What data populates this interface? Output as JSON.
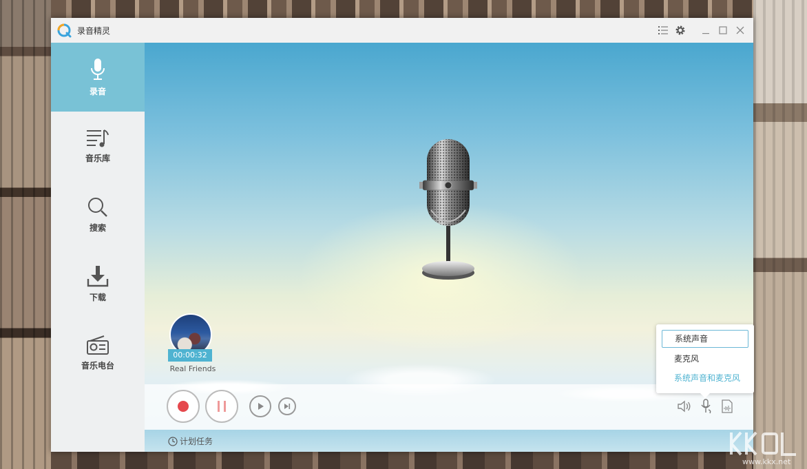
{
  "window": {
    "title": "录音精灵",
    "accent_color": "#79c2d6",
    "controls": {
      "list": "list-icon",
      "settings": "gear-icon",
      "minimize": "minimize-icon",
      "maximize": "maximize-icon",
      "close": "close-icon"
    }
  },
  "sidebar": {
    "items": [
      {
        "label": "录音",
        "icon": "microphone-icon",
        "active": true
      },
      {
        "label": "音乐库",
        "icon": "music-list-icon",
        "active": false
      },
      {
        "label": "搜索",
        "icon": "search-icon",
        "active": false
      },
      {
        "label": "下载",
        "icon": "download-icon",
        "active": false
      },
      {
        "label": "音乐电台",
        "icon": "radio-icon",
        "active": false
      }
    ]
  },
  "track": {
    "time": "00:00:32",
    "name": "Real Friends"
  },
  "controls": {
    "record": "record-icon",
    "pause": "pause-icon",
    "play": "play-icon",
    "next": "next-icon",
    "record_color": "#e5484d"
  },
  "source_menu": {
    "options": [
      "系统声音",
      "麦克风",
      "系统声音和麦克风"
    ],
    "selected": "系统声音"
  },
  "statusbar": {
    "schedule_label": "计划任务"
  },
  "watermark": {
    "text": "www.kkx.net"
  }
}
